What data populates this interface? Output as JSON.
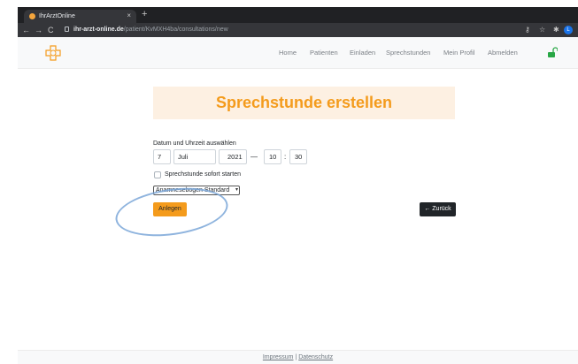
{
  "browser": {
    "tab_title": "IhrArztOnline",
    "tab_close": "×",
    "new_tab": "+",
    "back": "←",
    "forward": "→",
    "reload": "C",
    "url_host": "ihr-arzt-online.de",
    "url_path": "/patient/KvMXH4ba/consultations/new",
    "icons": [
      "key-icon",
      "star-icon",
      "extensions-icon",
      "profile-icon"
    ],
    "profile_initial": "L"
  },
  "navbar": {
    "brand_icon": "medical-cross-logo-icon",
    "items": [
      {
        "label": "Home"
      },
      {
        "label": "Patienten"
      },
      {
        "label": "Einladen"
      },
      {
        "label": "Sprechstunden"
      },
      {
        "label": "Mein Profil"
      },
      {
        "label": "Abmelden"
      }
    ],
    "lock_icon": "unlocked-icon",
    "accent": "#28a745"
  },
  "main": {
    "title": "Sprechstunde erstellen",
    "title_color": "#f49b1c",
    "banner_bg": "#fdf0e2",
    "datetime_label": "Datum und Uhrzeit auswählen",
    "day": "7",
    "month": "Juli",
    "year": "2021",
    "dash": "—",
    "hour": "10",
    "colon": ":",
    "minute": "30",
    "start_now_label": "Sprechstunde sofort starten",
    "start_now_checked": false,
    "form_select": "Anamnesebogen Standard",
    "create_button": "Anlegen",
    "back_button": "← Zurück",
    "button_color": "#f49b1c"
  },
  "footer": {
    "impressum": "Impressum",
    "separator": " | ",
    "privacy": "Datenschutz"
  }
}
